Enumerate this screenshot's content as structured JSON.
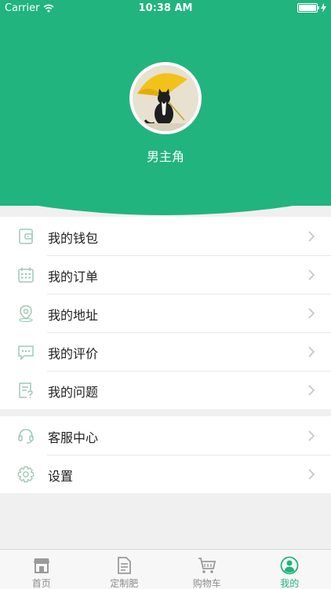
{
  "status_bar": {
    "carrier": "Carrier",
    "time": "10:38 AM"
  },
  "profile": {
    "username": "男主角"
  },
  "menu_group_1": [
    {
      "label": "我的钱包",
      "icon": "wallet-icon"
    },
    {
      "label": "我的订单",
      "icon": "calendar-icon"
    },
    {
      "label": "我的地址",
      "icon": "location-pin-icon"
    },
    {
      "label": "我的评价",
      "icon": "comment-icon"
    },
    {
      "label": "我的问题",
      "icon": "question-doc-icon"
    }
  ],
  "menu_group_2": [
    {
      "label": "客服中心",
      "icon": "headset-icon"
    },
    {
      "label": "设置",
      "icon": "gear-icon"
    }
  ],
  "tabbar": [
    {
      "label": "首页",
      "icon": "shop-icon"
    },
    {
      "label": "定制肥",
      "icon": "document-icon"
    },
    {
      "label": "购物车",
      "icon": "cart-icon"
    },
    {
      "label": "我的",
      "icon": "person-icon"
    }
  ],
  "colors": {
    "accent": "#21b47e",
    "icon_tint": "#9fc9b7",
    "background": "#f0f0f0"
  }
}
